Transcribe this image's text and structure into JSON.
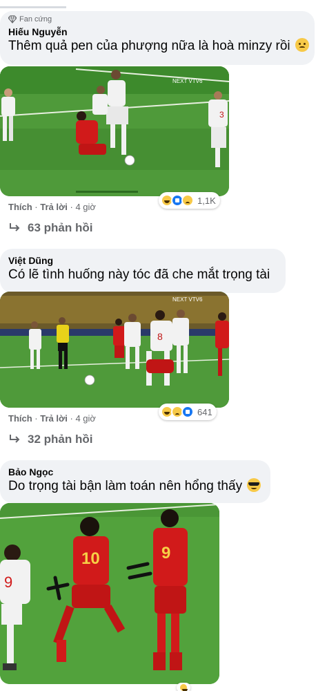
{
  "comments": [
    {
      "badge": "Fan cứng",
      "author": "Hiếu Nguyễn",
      "text": "Thêm quả pen của phượng nữa là hoà minzy rồi",
      "emoji": "sad-face-icon",
      "actions": {
        "like": "Thích",
        "reply": "Trả lời",
        "time": "4 giờ"
      },
      "reactions": {
        "icons": [
          "haha-icon",
          "like-icon",
          "sad-icon"
        ],
        "count": "1,1K"
      },
      "replies": "63 phản hồi"
    },
    {
      "author": "Việt Dũng",
      "text": "Có lẽ tình huống này tóc đã che mắt trọng tài",
      "actions": {
        "like": "Thích",
        "reply": "Trả lời",
        "time": "4 giờ"
      },
      "reactions": {
        "icons": [
          "haha-icon",
          "sad-icon",
          "like-icon"
        ],
        "count": "641"
      },
      "replies": "32 phản hồi"
    },
    {
      "author": "Bảo Ngọc",
      "text": "Do trọng tài bận làm toán nên hổng thấy",
      "emoji": "cool-face-icon"
    }
  ],
  "separator": "·",
  "colors": {
    "bubble": "#f0f2f5",
    "pitch": "#3f8a2f",
    "red_kit": "#d11a1a",
    "white_kit": "#f2f2f2",
    "muted": "#65676b"
  }
}
